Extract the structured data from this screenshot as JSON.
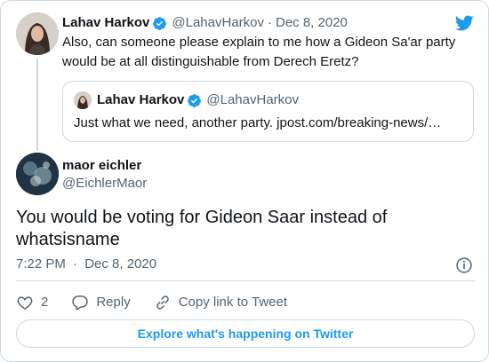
{
  "parent": {
    "name": "Lahav Harkov",
    "handle": "@LahavHarkov",
    "separator": "·",
    "date": "Dec 8, 2020",
    "text": "Also, can someone please explain to me how a Gideon Sa'ar party would be at all distinguishable from Derech Eretz?"
  },
  "quote": {
    "name": "Lahav Harkov",
    "handle": "@LahavHarkov",
    "text": "Just what we need, another party.  jpost.com/breaking-news/…"
  },
  "tweet": {
    "name": "maor eichler",
    "handle": "@EichlerMaor",
    "text": "You would be voting for Gideon Saar instead of whatsisname",
    "time": "7:22 PM",
    "separator": "·",
    "date": "Dec 8, 2020"
  },
  "actions": {
    "like_count": "2",
    "reply_label": "Reply",
    "copy_label": "Copy link to Tweet"
  },
  "explore_label": "Explore what's happening on Twitter",
  "colors": {
    "accent": "#1d9bf0",
    "text": "#0f1419",
    "muted": "#536471",
    "border": "#cfd9de"
  },
  "icons": [
    "twitter-bird-icon",
    "verified-badge-icon",
    "info-icon",
    "heart-icon",
    "reply-icon",
    "link-icon"
  ]
}
